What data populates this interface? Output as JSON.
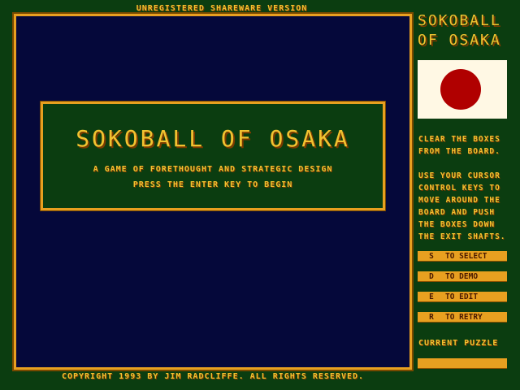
{
  "banner": "UNREGISTERED SHAREWARE VERSION",
  "title_panel": {
    "title": "SOKOBALL OF OSAKA",
    "subtitle": "A GAME OF FORETHOUGHT AND STRATEGIC DESIGN",
    "prompt": "PRESS THE ENTER KEY TO BEGIN"
  },
  "copyright": "COPYRIGHT 1993 BY JIM RADCLIFFE.   ALL RIGHTS RESERVED.",
  "sidebar": {
    "title_line1": "SOKOBALL",
    "title_line2": "OF OSAKA",
    "instructions1": [
      "CLEAR THE BOXES",
      "FROM THE BOARD."
    ],
    "instructions2": [
      "USE YOUR CURSOR",
      "CONTROL KEYS TO",
      "MOVE AROUND THE",
      "BOARD AND PUSH",
      "THE BOXES DOWN",
      "THE EXIT SHAFTS."
    ],
    "buttons": [
      {
        "key": "S",
        "label": "TO SELECT"
      },
      {
        "key": "D",
        "label": "TO DEMO"
      },
      {
        "key": "E",
        "label": "TO EDIT"
      },
      {
        "key": "R",
        "label": "TO RETRY"
      }
    ],
    "current_label": "CURRENT PUZZLE",
    "current_value": ""
  },
  "colors": {
    "background": "#0b3d10",
    "board": "#05083a",
    "accent": "#e8a020",
    "text": "#f2c230",
    "flag_sun": "#b00000"
  }
}
